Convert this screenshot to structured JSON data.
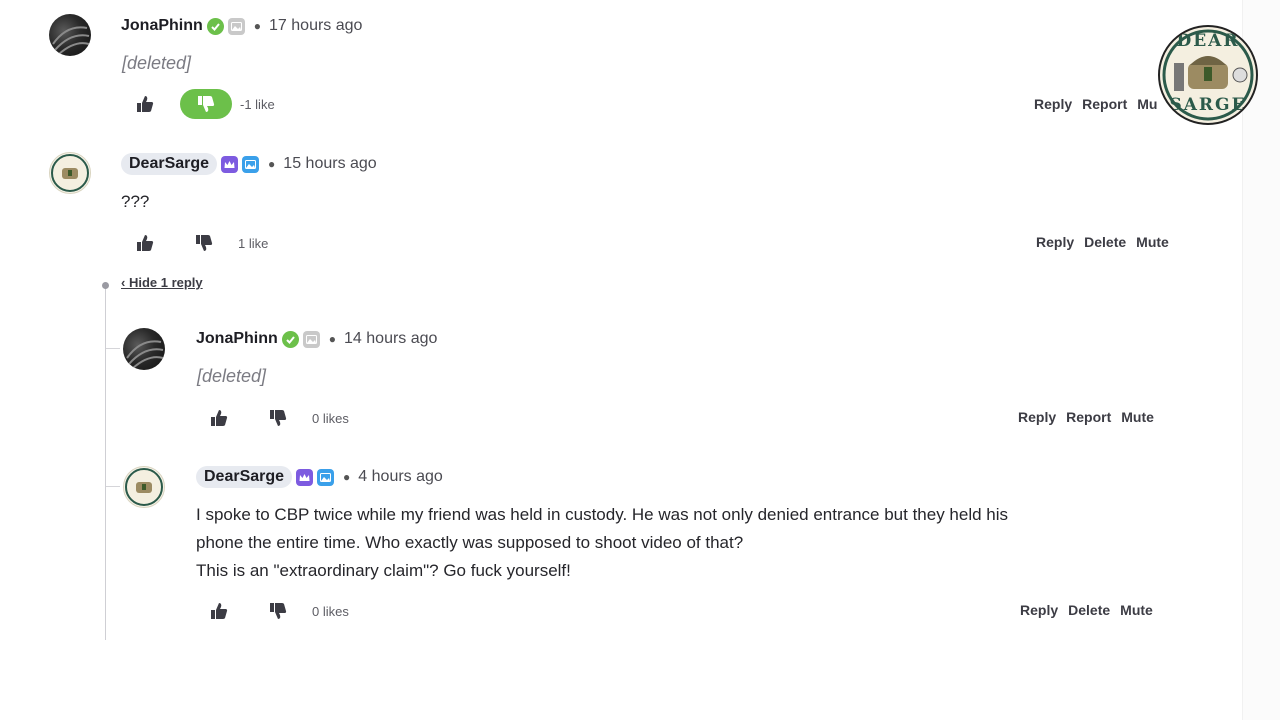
{
  "logo": {
    "text_top": "DEAR",
    "text_bottom": "SARGE",
    "icon": "dear-sarge-seal"
  },
  "comments": [
    {
      "username": "JonaPhinn",
      "time": "17 hours ago",
      "body": "[deleted]",
      "likes": "-1 like",
      "actions": [
        "Reply",
        "Report",
        "Mu"
      ]
    },
    {
      "username": "DearSarge",
      "time": "15 hours ago",
      "body": "???",
      "likes": "1 like",
      "actions": [
        "Reply",
        "Delete",
        "Mute"
      ]
    }
  ],
  "hide_replies": "‹ Hide 1 reply",
  "replies": [
    {
      "username": "JonaPhinn",
      "time": "14 hours ago",
      "body": "[deleted]",
      "likes": "0 likes",
      "actions": [
        "Reply",
        "Report",
        "Mute"
      ]
    },
    {
      "username": "DearSarge",
      "time": "4 hours ago",
      "body_lines": [
        "I spoke to CBP twice while my friend was held in custody. He was not only denied entrance but they held his",
        "phone the entire time. Who exactly was supposed to shoot video of that?",
        "This is an \"extraordinary claim\"? Go fuck yourself!"
      ],
      "likes": "0 likes",
      "actions": [
        "Reply",
        "Delete",
        "Mute"
      ]
    }
  ],
  "colors": {
    "accent_green": "#6cc04a",
    "badge_purple": "#7d5be0",
    "badge_blue": "#3aa0ea"
  }
}
